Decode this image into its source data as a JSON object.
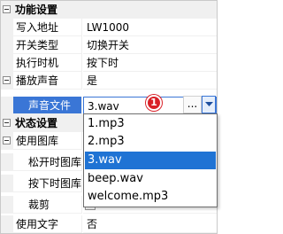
{
  "categories": {
    "func": "功能设置",
    "state": "状态设置"
  },
  "func_rows": [
    {
      "name": "写入地址",
      "value": "LW1000"
    },
    {
      "name": "开关类型",
      "value": "切换开关"
    },
    {
      "name": "执行时机",
      "value": "按下时"
    }
  ],
  "play_sound": {
    "name": "播放声音",
    "value": "是"
  },
  "sound_file": {
    "name": "声音文件",
    "value": "3.wav",
    "ellipsis": "..."
  },
  "badge": "1",
  "dropdown": {
    "options": [
      "1.mp3",
      "2.mp3",
      "3.wav",
      "beep.wav",
      "welcome.mp3"
    ],
    "selected_index": 2
  },
  "state_rows": {
    "use_library": {
      "name": "使用图库"
    },
    "release_lib": {
      "name": "松开时图库"
    },
    "press_lib": {
      "name": "按下时图库"
    },
    "crop": {
      "name": "裁剪"
    },
    "use_text": {
      "name": "使用文字",
      "value": "否"
    }
  },
  "colors": {
    "accent": "#3a76d6",
    "selected_option": "#1f73d4",
    "badge": "#d92027"
  }
}
